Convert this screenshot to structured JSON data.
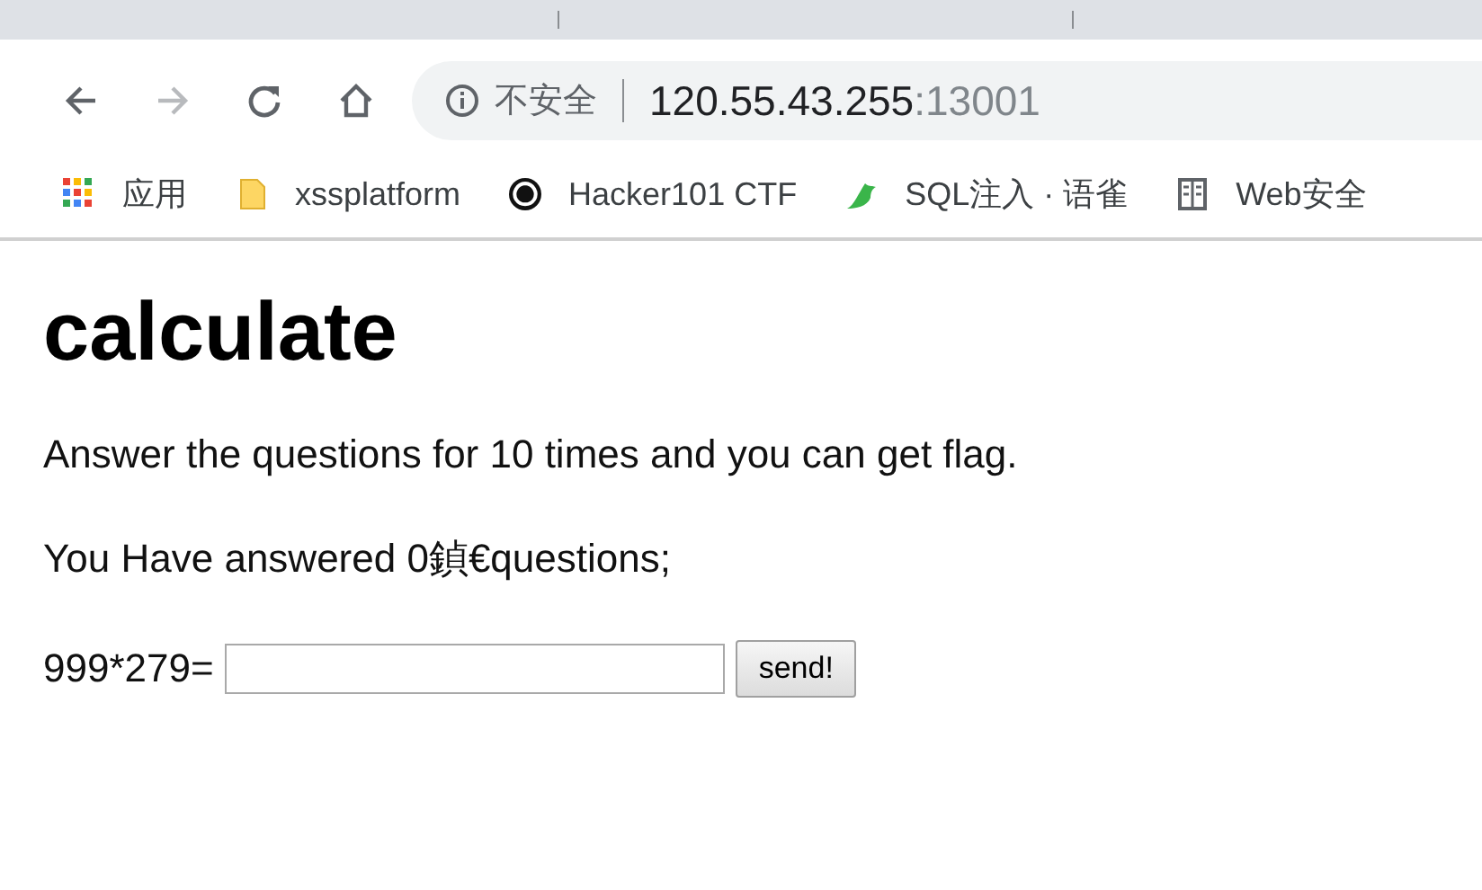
{
  "browser": {
    "security_label": "不安全",
    "url_host": "120.55.43.255",
    "url_port": ":13001",
    "bookmarks": [
      {
        "kind": "apps",
        "label": "应用"
      },
      {
        "kind": "folder",
        "label": "xssplatform"
      },
      {
        "kind": "swirl",
        "label": "Hacker101 CTF"
      },
      {
        "kind": "bird",
        "label": "SQL注入 · 语雀"
      },
      {
        "kind": "book",
        "label": "Web安全"
      }
    ]
  },
  "page": {
    "heading": "calculate",
    "paragraphs": [
      "Answer the questions for 10 times and you can get flag.",
      "You Have answered 0鍞€questions;"
    ],
    "question": "999*279=",
    "submit": "send!"
  }
}
